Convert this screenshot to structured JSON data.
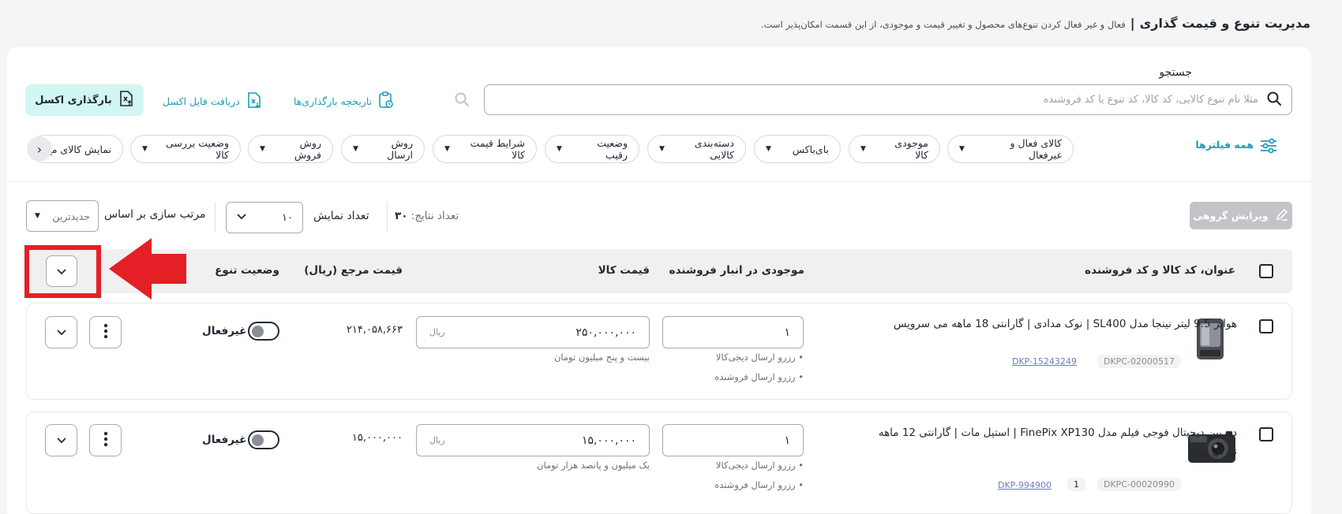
{
  "header": {
    "title": "مدیریت تنوع و قیمت گذاری",
    "subtitle": "فعال و غیر فعال کردن تنوع‌های محصول و تغییر قیمت و موجودی، از این قسمت امکان‌پذیر است."
  },
  "search": {
    "label": "جستجو",
    "placeholder": "مثلا نام تنوع کالایی، کد کالا، کد تنوع یا کد فروشنده"
  },
  "actions": {
    "upload_history": "تاریخچه بارگذاری‌ها",
    "download_excel": "دریافت فایل اکسل",
    "upload_excel": "بارگذاری اکسل"
  },
  "filters": {
    "all_filters": "همه فیلترها",
    "chips": [
      "کالای فعال و غیرفعال",
      "موجودی کالا",
      "بای‌باکس",
      "دسته‌بندی کالایی",
      "وضعیت رقیب",
      "شرایط قیمت کالا",
      "روش ارسال",
      "روش فروش",
      "وضعیت بررسی کالا",
      "نمایش کالای مخ"
    ]
  },
  "toolbar": {
    "group_edit": "ویرایش گروهی",
    "results_label": "تعداد نتایج:",
    "results_value": "۳۰",
    "per_page_label": "تعداد نمایش",
    "per_page_value": "۱۰",
    "sort_label": "مرتب سازی بر اساس",
    "sort_value": "جدیدترین"
  },
  "table": {
    "headers": {
      "title": "عنوان، کد کالا و کد فروشنده",
      "stock": "موجودی در انبار فروشنده",
      "price": "قیمت کالا",
      "ref_price": "قیمت مرجع (ریال)",
      "status": "وضعیت تنوع"
    },
    "rows": [
      {
        "title": "هواپز 9.5 لیتر نینجا مدل SL400 | نوک مدادی | گارانتی 18 ماهه می سرویس",
        "sku_a": "DKPC-02000517",
        "sku_b": "DKP-15243249",
        "qty": "۱",
        "reserve_dk": "• رزرو ارسال دیجی‌کالا",
        "reserve_seller": "• رزرو ارسال فروشنده",
        "price": "۲۵۰,۰۰۰,۰۰۰",
        "price_unit": "ریال",
        "price_words": "بیست و پنج میلیون تومان",
        "ref_price": "۲۱۴,۰۵۸,۶۶۳",
        "status": "غیرفعال"
      },
      {
        "title": "دوربین دیجیتال فوجی فیلم مدل FinePix XP130 | استیل مات | گارانتی 12 ماهه تهران فوکا",
        "sku_a": "DKPC-00020990",
        "sku_b": "DKP-994900",
        "badge": "1",
        "qty": "۱",
        "reserve_dk": "• رزرو ارسال دیجی‌کالا",
        "reserve_seller": "• رزرو ارسال فروشنده",
        "price": "۱۵,۰۰۰,۰۰۰",
        "price_unit": "ریال",
        "price_words": "یک میلیون و پانصد هزار تومان",
        "ref_price": "۱۵,۰۰۰,۰۰۰",
        "status": "غیرفعال"
      }
    ]
  },
  "colors": {
    "accent": "#1f9cb8",
    "excel_bg": "#d2f6f1",
    "highlight": "#e41f26"
  }
}
